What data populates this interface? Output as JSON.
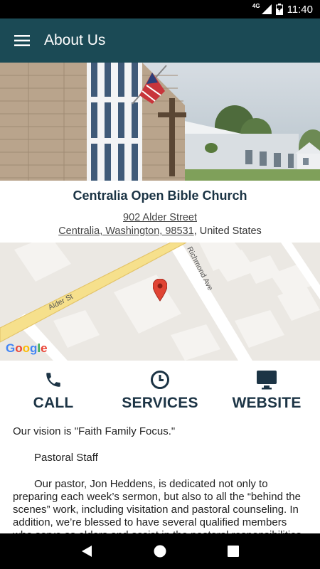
{
  "status_bar": {
    "network": "4G",
    "time": "11:40"
  },
  "app_bar": {
    "title": "About Us"
  },
  "church": {
    "name": "Centralia Open Bible Church",
    "address_line1": "902 Alder Street",
    "address_line2_link": "Centralia, Washington, 98531",
    "address_line2_suffix": ", United States"
  },
  "map": {
    "street_1": "Alder St",
    "street_2": "Richmond Ave",
    "provider": "Google"
  },
  "actions": [
    {
      "label": "CALL",
      "icon": "phone-icon"
    },
    {
      "label": "SERVICES",
      "icon": "clock-icon"
    },
    {
      "label": "WEBSITE",
      "icon": "monitor-icon"
    }
  ],
  "content": {
    "vision": "Our vision is \"Faith Family Focus.\"",
    "staff_heading": "Pastoral Staff",
    "pastor_paragraph": "Our pastor, Jon Heddens, is dedicated not only to preparing each week’s sermon, but also to all the “behind the scenes” work, including visitation and pastoral counseling. In addition, we’re blessed to have several qualified members who serve as elders and assist in the pastoral responsibilities."
  },
  "colors": {
    "app_bar": "#1b4a55",
    "action_text": "#1c3445",
    "road_major": "#f6e08c",
    "map_bg": "#ebe8e3",
    "pin": "#e04434"
  }
}
